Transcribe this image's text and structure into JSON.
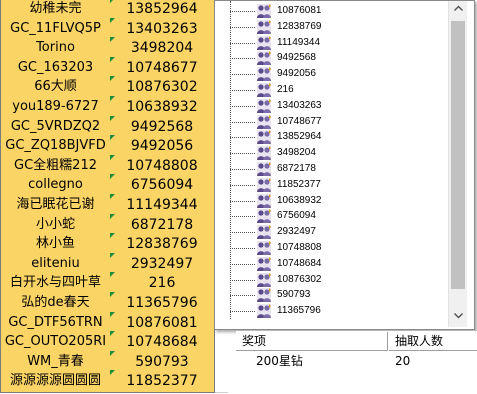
{
  "sheet": {
    "rows": [
      {
        "name": "幼稚未完",
        "id": "13852964"
      },
      {
        "name": "GC_11FLVQ5P",
        "id": "13403263"
      },
      {
        "name": "Torino",
        "id": "3498204"
      },
      {
        "name": "GC_163203",
        "id": "10748677"
      },
      {
        "name": "66大顺",
        "id": "10876302"
      },
      {
        "name": "you189-6727",
        "id": "10638932"
      },
      {
        "name": "GC_5VRDZQ2",
        "id": "9492568"
      },
      {
        "name": "GC_ZQ18BJVFD",
        "id": "9492056"
      },
      {
        "name": "GC全粗糯212",
        "id": "10748808"
      },
      {
        "name": "collegno",
        "id": "6756094"
      },
      {
        "name": "海已眠花已谢",
        "id": "11149344"
      },
      {
        "name": "小小蛇",
        "id": "6872178"
      },
      {
        "name": "林小鱼",
        "id": "12838769"
      },
      {
        "name": "eliteniu",
        "id": "2932497"
      },
      {
        "name": "白开水与四叶草",
        "id": "216"
      },
      {
        "name": "弘的de春天",
        "id": "11365796"
      },
      {
        "name": "GC_DTF56TRN",
        "id": "10876081"
      },
      {
        "name": "GC_OUTO205RI",
        "id": "10748684"
      },
      {
        "name": "WM_青春",
        "id": "590793"
      },
      {
        "name": "源源源源圆圆圆",
        "id": "11852377"
      }
    ]
  },
  "tree": {
    "items": [
      "10876081",
      "12838769",
      "11149344",
      "9492568",
      "9492056",
      "216",
      "13403263",
      "10748677",
      "13852964",
      "3498204",
      "6872178",
      "11852377",
      "10638932",
      "6756094",
      "2932497",
      "10748808",
      "10748684",
      "10876302",
      "590793",
      "11365796"
    ],
    "icon": "user-group-icon"
  },
  "table": {
    "headers": [
      "奖项",
      "抽取人数"
    ],
    "rows": [
      {
        "prize": "200星钻",
        "count": "20"
      }
    ]
  },
  "colors": {
    "cell": "#fbd466",
    "marker": "#1e8a3a",
    "icon": "#5a4a8a"
  }
}
